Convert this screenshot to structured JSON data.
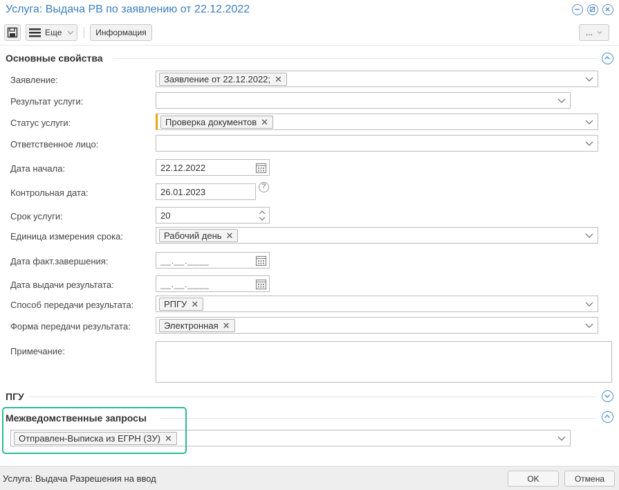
{
  "window": {
    "title": "Услуга: Выдача РВ по заявлению от 22.12.2022"
  },
  "toolbar": {
    "more_label": "Еще",
    "info_label": "Информация",
    "overflow_label": "..."
  },
  "sections": {
    "main": "Основные свойства",
    "pgu": "ПГУ",
    "interdept": "Межведомственные запросы"
  },
  "fields": {
    "application": {
      "label": "Заявление:",
      "chip": "Заявление от 22.12.2022;"
    },
    "result": {
      "label": "Результат услуги:"
    },
    "status": {
      "label": "Статус услуги:",
      "chip": "Проверка документов"
    },
    "responsible": {
      "label": "Ответственное лицо:"
    },
    "start_date": {
      "label": "Дата начала:",
      "value": "22.12.2022"
    },
    "control_date": {
      "label": "Контрольная дата:",
      "value": "26.01.2023"
    },
    "term": {
      "label": "Срок услуги:",
      "value": "20"
    },
    "term_unit": {
      "label": "Единица измерения срока:",
      "chip": "Рабочий день"
    },
    "actual_end": {
      "label": "Дата факт.завершения:",
      "placeholder": "__.__.____"
    },
    "issue_date": {
      "label": "Дата выдачи результата:",
      "placeholder": "__.__.____"
    },
    "transfer_method": {
      "label": "Способ передачи результата:",
      "chip": "РПГУ"
    },
    "transfer_form": {
      "label": "Форма передачи результата:",
      "chip": "Электронная"
    },
    "note": {
      "label": "Примечание:"
    },
    "interdept_request": {
      "chip": "Отправлен-Выписка из ЕГРН (ЗУ)"
    }
  },
  "statusbar": {
    "text": "Услуга: Выдача Разрешения на ввод",
    "ok_label": "OK",
    "cancel_label": "Отмена"
  },
  "colors": {
    "title": "#3a7fc0",
    "accent_required": "#f0a30a",
    "highlight": "#2db894"
  }
}
